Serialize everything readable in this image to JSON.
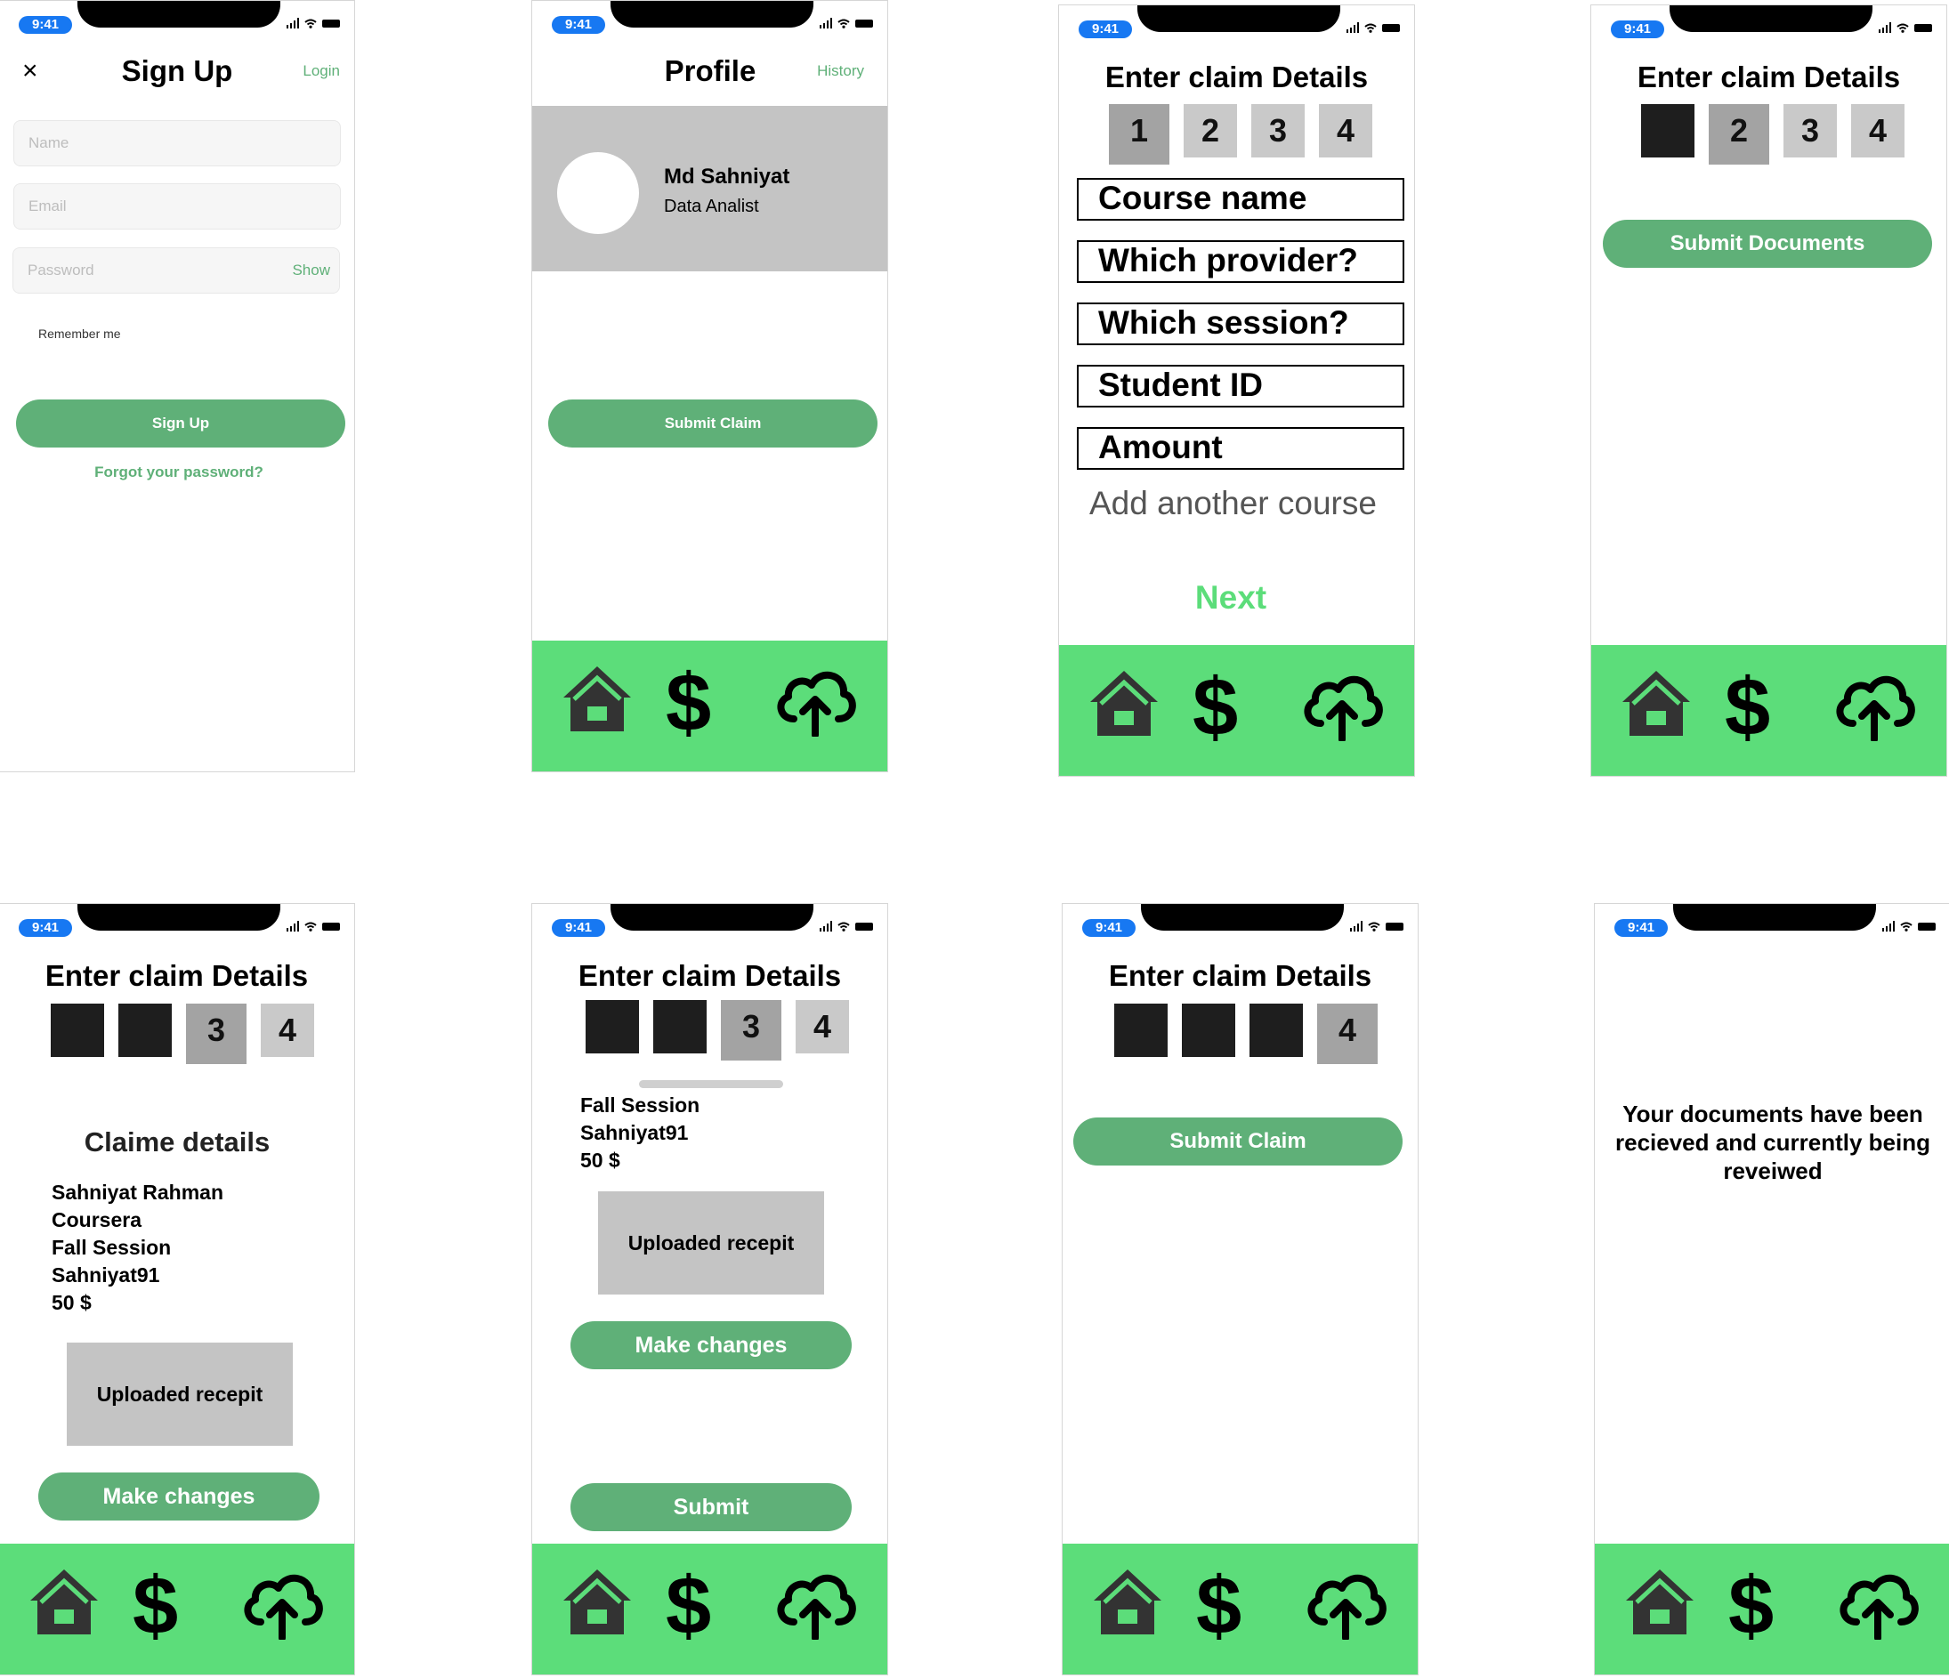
{
  "status_time": "9:41",
  "nav_icons": [
    "home-icon",
    "dollar-icon",
    "cloud-upload-icon"
  ],
  "colors": {
    "nav_green": "#5cdd7a",
    "button_green": "#5fb078",
    "link_green": "#5fb078",
    "time_pill": "#1778f2"
  },
  "signup": {
    "close": "×",
    "title": "Sign Up",
    "login_link": "Login",
    "name_placeholder": "Name",
    "email_placeholder": "Email",
    "password_placeholder": "Password",
    "show_label": "Show",
    "remember_label": "Remember me",
    "signup_button": "Sign Up",
    "forgot_link": "Forgot your password?"
  },
  "profile": {
    "title": "Profile",
    "history_link": "History",
    "user_name": "Md Sahniyat",
    "user_role": "Data Analist",
    "submit_button": "Submit Claim"
  },
  "claim_common": {
    "title": "Enter claim Details",
    "steps": [
      "1",
      "2",
      "3",
      "4"
    ]
  },
  "claim_step1": {
    "fields": [
      "Course name",
      "Which provider?",
      "Which session?",
      "Student ID",
      "Amount"
    ],
    "add_course": "Add another course",
    "next": "Next"
  },
  "claim_step2": {
    "submit_documents": "Submit Documents"
  },
  "claim_step3a": {
    "section_title": "Claime details",
    "lines": [
      "Sahniyat Rahman",
      "Coursera",
      "Fall Session",
      "Sahniyat91",
      "50 $"
    ],
    "receipt": "Uploaded recepit",
    "make_changes": "Make changes"
  },
  "claim_step3b": {
    "lines": [
      "Fall Session",
      "Sahniyat91",
      "50 $"
    ],
    "receipt": "Uploaded recepit",
    "make_changes": "Make changes",
    "submit": "Submit"
  },
  "claim_step4": {
    "submit_claim": "Submit Claim"
  },
  "confirmation": {
    "message": "Your documents have been recieved and currently being reveiwed"
  }
}
